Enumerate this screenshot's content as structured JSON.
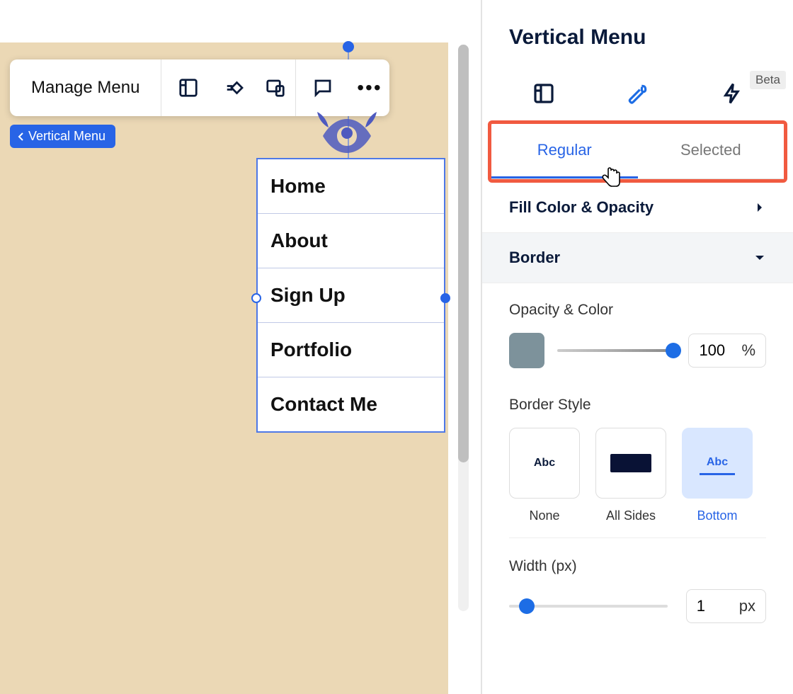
{
  "toolbar": {
    "manage_label": "Manage Menu"
  },
  "breadcrumb": {
    "label": "Vertical Menu"
  },
  "menu": {
    "items": [
      "Home",
      "About",
      "Sign Up",
      "Portfolio",
      "Contact Me"
    ],
    "selected_index": 2
  },
  "panel": {
    "title": "Vertical Menu",
    "beta_tag": "Beta",
    "state_tabs": {
      "regular": "Regular",
      "selected": "Selected",
      "active": "regular"
    },
    "sections": {
      "fill": {
        "label": "Fill Color & Opacity"
      },
      "border": {
        "label": "Border",
        "opacity_label": "Opacity & Color",
        "opacity_value": "100",
        "opacity_unit": "%",
        "swatch_color": "#7d929b",
        "style_label": "Border Style",
        "styles": {
          "none": "None",
          "all": "All Sides",
          "bottom": "Bottom",
          "preview_text": "Abc",
          "selected": "bottom"
        },
        "width_label": "Width (px)",
        "width_value": "1",
        "width_unit": "px"
      }
    }
  }
}
